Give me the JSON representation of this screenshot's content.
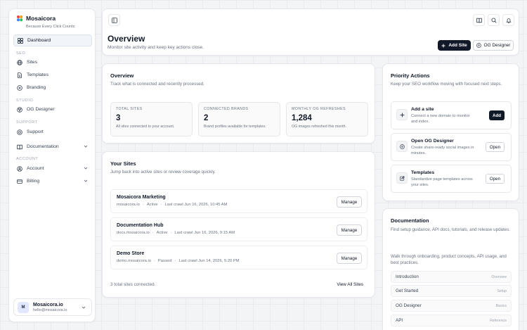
{
  "app": {
    "name": "Mosaicora",
    "tagline": "Because Every Click Counts",
    "logo_colors": [
      "#ef4444",
      "#f59e0b",
      "#3b82f6",
      "#22c55e"
    ]
  },
  "sidebar": {
    "main": [
      {
        "label": "Dashboard",
        "icon": "grid-icon",
        "active": true
      }
    ],
    "sections": [
      {
        "title": "SEO",
        "items": [
          {
            "label": "Sites",
            "icon": "globe-icon"
          },
          {
            "label": "Templates",
            "icon": "file-icon"
          },
          {
            "label": "Branding",
            "icon": "palette-icon"
          }
        ]
      },
      {
        "title": "STUDIO",
        "items": [
          {
            "label": "OG Designer",
            "icon": "image-icon"
          }
        ]
      },
      {
        "title": "SUPPORT",
        "items": [
          {
            "label": "Support",
            "icon": "lifebuoy-icon"
          },
          {
            "label": "Documentation",
            "icon": "book-icon",
            "expandable": true
          }
        ]
      },
      {
        "title": "ACCOUNT",
        "items": [
          {
            "label": "Account",
            "icon": "user-icon",
            "expandable": true
          },
          {
            "label": "Billing",
            "icon": "credit-card-icon",
            "expandable": true
          }
        ]
      }
    ],
    "user": {
      "initials": "M",
      "name": "Mosaicora.io",
      "email": "hello@mosaicora.io"
    }
  },
  "header": {
    "title": "Overview",
    "subtitle": "Monitor site activity and keep key actions close.",
    "add_site_label": "Add Site",
    "og_designer_label": "OG Designer"
  },
  "overview": {
    "title": "Overview",
    "subtitle": "Track what is connected and recently processed.",
    "stats": [
      {
        "label": "TOTAL SITES",
        "value": "3",
        "desc": "All sites connected to your account."
      },
      {
        "label": "CONNECTED BRANDS",
        "value": "2",
        "desc": "Brand profiles available for templates."
      },
      {
        "label": "MONTHLY OG REFRESHES",
        "value": "1,284",
        "desc": "OG images refreshed this month."
      }
    ]
  },
  "sites": {
    "title": "Your Sites",
    "subtitle": "Jump back into active sites or review coverage quickly.",
    "rows": [
      {
        "name": "Mosaicora Marketing",
        "domain": "mosaicora.io",
        "status": "Active",
        "crawl": "Last crawl Jun 16, 2026, 10:45 AM",
        "action": "Manage"
      },
      {
        "name": "Documentation Hub",
        "domain": "docs.mosaicora.io",
        "status": "Active",
        "crawl": "Last crawl Jun 16, 2026, 9:15 AM",
        "action": "Manage"
      },
      {
        "name": "Demo Store",
        "domain": "demo.mosaicora.io",
        "status": "Paused",
        "crawl": "Last crawl Jun 14, 2026, 5:20 PM",
        "action": "Manage"
      }
    ],
    "footer": "3 total sites connected.",
    "view_all": "View All Sites"
  },
  "priority": {
    "title": "Priority Actions",
    "subtitle": "Keep your SEO workflow moving with focused next steps.",
    "actions": [
      {
        "title": "Add a site",
        "desc": "Connect a new domain to monitor and index.",
        "button": "Add",
        "icon": "plus-icon"
      },
      {
        "title": "Open OG Designer",
        "desc": "Create share-ready social images in minutes.",
        "button": "Open",
        "icon": "palette-icon"
      },
      {
        "title": "Templates",
        "desc": "Standardize page templates across your sites.",
        "button": "Open",
        "icon": "edit-icon"
      }
    ]
  },
  "docs": {
    "title": "Documentation",
    "subtitle": "Find setup guidance, API docs, tutorials, and release updates.",
    "intro": "Walk through onboarding, product concepts, API usage, and best practices.",
    "links": [
      {
        "name": "Introduction",
        "tag": "Overview"
      },
      {
        "name": "Get Started",
        "tag": "Setup"
      },
      {
        "name": "OG Designer",
        "tag": "Basics"
      },
      {
        "name": "API",
        "tag": "Reference"
      }
    ]
  }
}
